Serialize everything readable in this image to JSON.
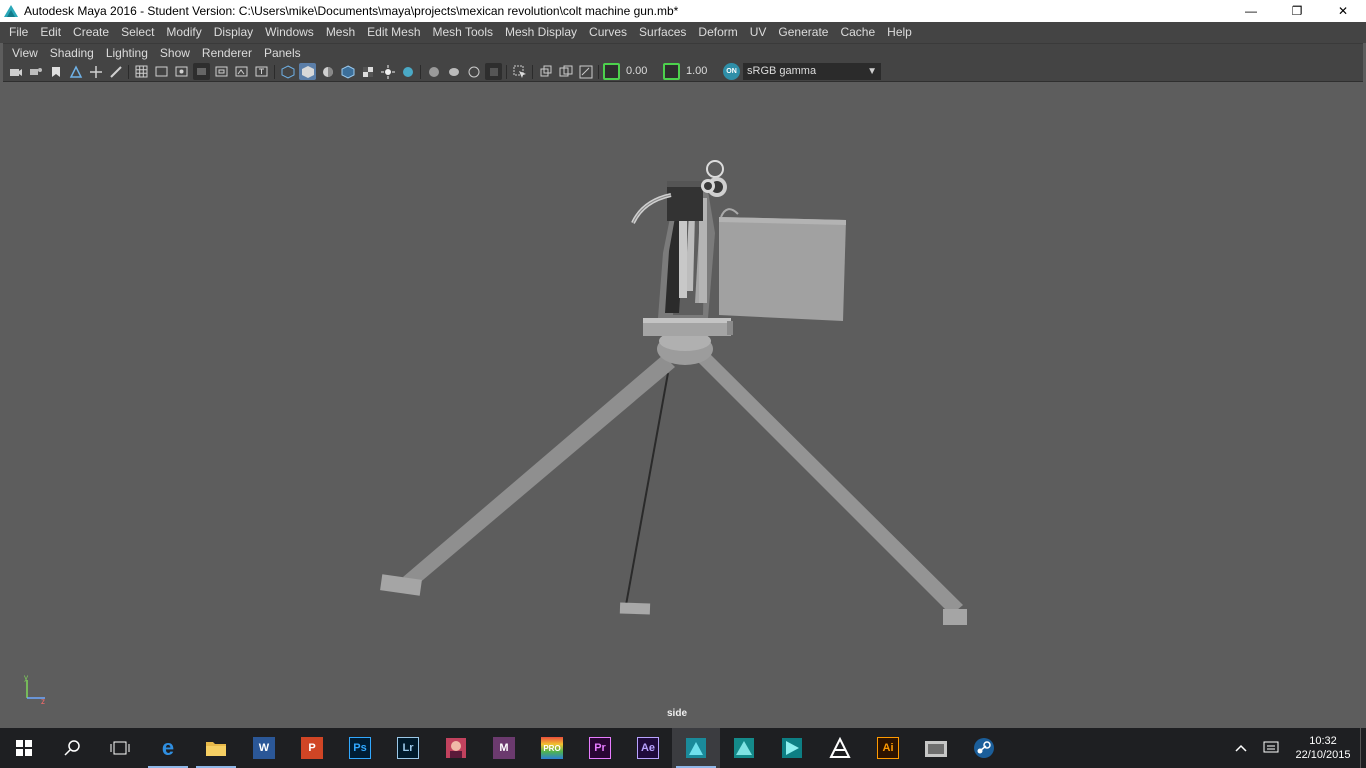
{
  "window": {
    "title": "Autodesk Maya 2016 - Student Version: C:\\Users\\mike\\Documents\\maya\\projects\\mexican revolution\\colt machine gun.mb*",
    "minimize": "—",
    "maximize": "❐",
    "close": "✕"
  },
  "main_menu": [
    "File",
    "Edit",
    "Create",
    "Select",
    "Modify",
    "Display",
    "Windows",
    "Mesh",
    "Edit Mesh",
    "Mesh Tools",
    "Mesh Display",
    "Curves",
    "Surfaces",
    "Deform",
    "UV",
    "Generate",
    "Cache",
    "Help"
  ],
  "panel_menu": [
    "View",
    "Shading",
    "Lighting",
    "Show",
    "Renderer",
    "Panels"
  ],
  "panel_toolbar": {
    "exposure_value": "0.00",
    "gamma_value": "1.00",
    "color_space": "sRGB gamma",
    "color_mgmt_icon_label": "ON"
  },
  "viewport": {
    "camera_label": "side",
    "axis_y": "y",
    "axis_z": "z"
  },
  "taskbar": {
    "apps": [
      {
        "name": "start-button",
        "icon": "windows-logo"
      },
      {
        "name": "search-button",
        "icon": "search-icon"
      },
      {
        "name": "task-view-button",
        "icon": "task-view-icon"
      },
      {
        "name": "edge-app",
        "icon": "edge-icon",
        "label": "e",
        "open": true
      },
      {
        "name": "file-explorer-app",
        "icon": "folder-icon",
        "open": true
      },
      {
        "name": "word-app",
        "icon": "word-icon",
        "label": "W"
      },
      {
        "name": "powerpoint-app",
        "icon": "powerpoint-icon",
        "label": "P"
      },
      {
        "name": "photoshop-app",
        "icon": "photoshop-icon",
        "label": "Ps"
      },
      {
        "name": "lightroom-app",
        "icon": "lightroom-icon",
        "label": "Lr"
      },
      {
        "name": "photo-app",
        "icon": "portrait-icon"
      },
      {
        "name": "mudbox-app",
        "icon": "mudbox-icon",
        "label": "M"
      },
      {
        "name": "pro-app",
        "icon": "pro-icon",
        "label": "PRO"
      },
      {
        "name": "premiere-app",
        "icon": "premiere-icon",
        "label": "Pr"
      },
      {
        "name": "after-effects-app",
        "icon": "after-effects-icon",
        "label": "Ae"
      },
      {
        "name": "maya-app",
        "icon": "maya-icon",
        "open": true,
        "active": true
      },
      {
        "name": "3dsmax-app",
        "icon": "3dsmax-icon"
      },
      {
        "name": "3ds-app",
        "icon": "3ds-icon"
      },
      {
        "name": "zbrush-app",
        "icon": "zbrush-icon"
      },
      {
        "name": "illustrator-app",
        "icon": "illustrator-icon",
        "label": "Ai"
      },
      {
        "name": "camera-app",
        "icon": "camera-icon"
      },
      {
        "name": "steam-app",
        "icon": "steam-icon"
      }
    ],
    "time": "10:32",
    "date": "22/10/2015"
  },
  "colors": {
    "viewport_bg": "#5d5d5d",
    "menu_bg": "#444444",
    "model_gray": "#9a9a9a",
    "taskbar_bg": "#1e1f22",
    "accent_blue": "#5b7ea8",
    "green": "#4dd14d"
  }
}
